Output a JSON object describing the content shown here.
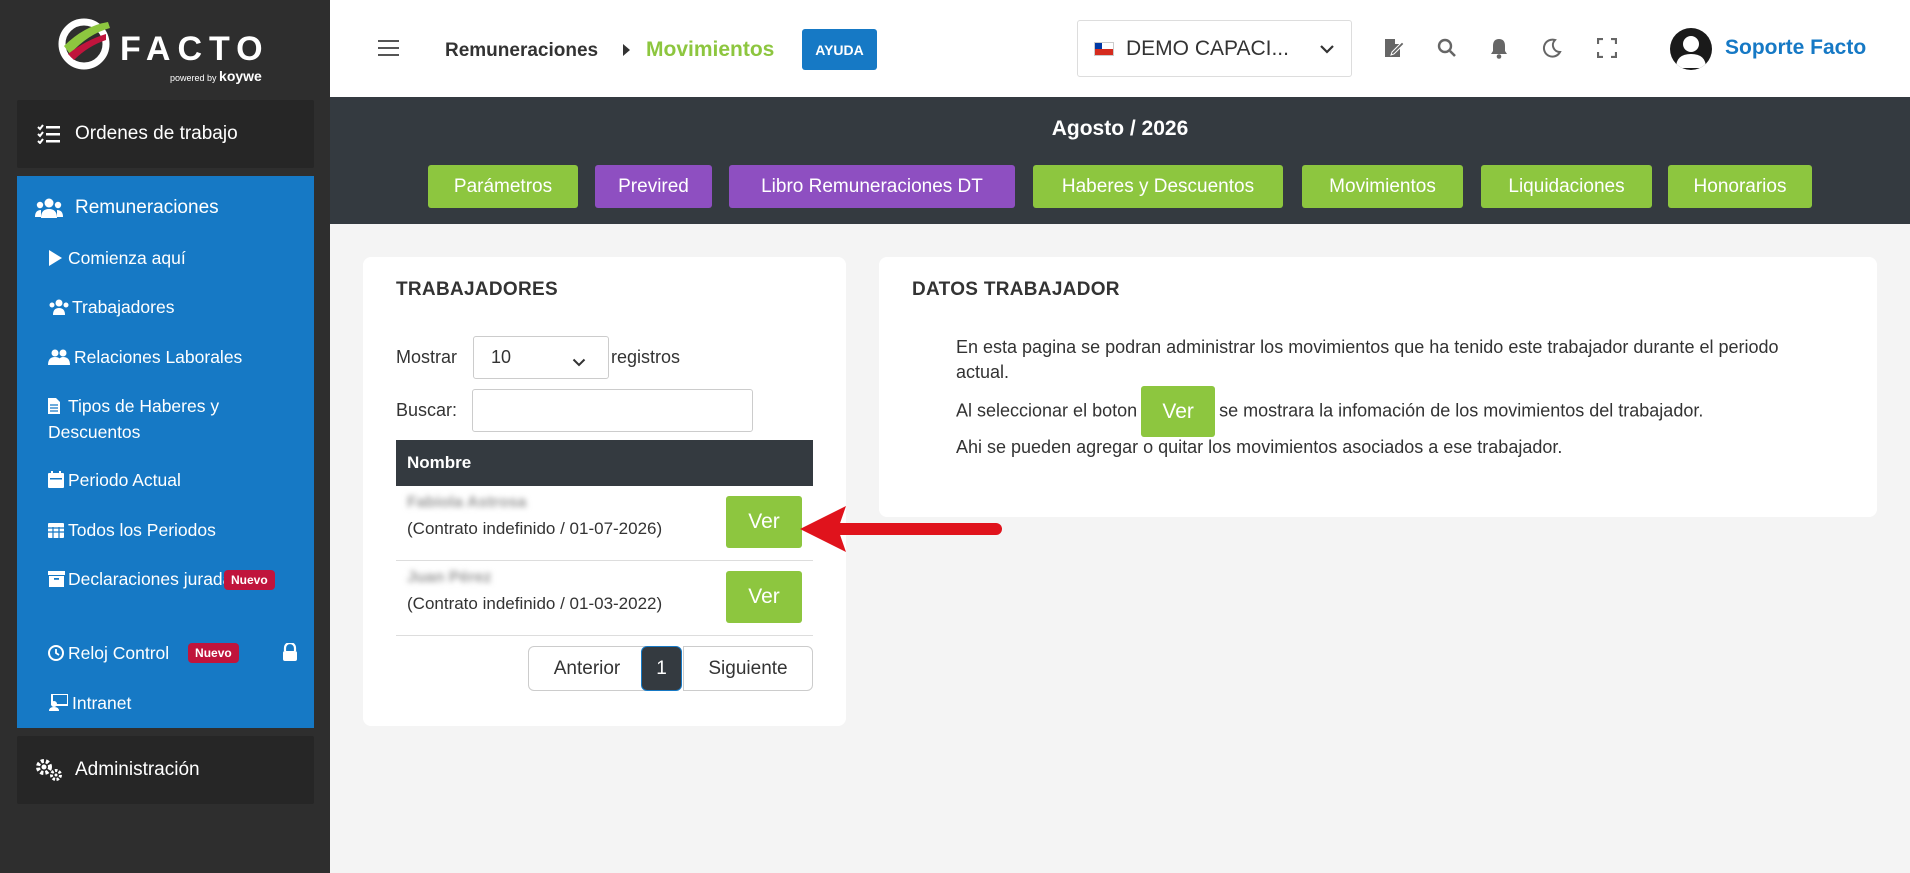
{
  "brand": {
    "name": "FACTO",
    "powered_by": "powered by",
    "partner": "koywe",
    "colors": {
      "green": "#8dc63f",
      "blue": "#1679c5",
      "purple": "#8e4fc1",
      "dark": "#343a40",
      "badge": "#c0143c"
    }
  },
  "sidebar": {
    "ordenes_label": "Ordenes de trabajo",
    "remuneraciones_label": "Remuneraciones",
    "items": [
      {
        "label": "Comienza aquí",
        "icon": "play-icon"
      },
      {
        "label": "Trabajadores",
        "icon": "users-icon"
      },
      {
        "label": "Relaciones Laborales",
        "icon": "user-group-icon"
      },
      {
        "label": "Tipos de Haberes y Descuentos",
        "icon": "file-icon"
      },
      {
        "label": "Periodo Actual",
        "icon": "calendar-icon"
      },
      {
        "label": "Todos los Periodos",
        "icon": "calendar-grid-icon"
      },
      {
        "label": "Declaraciones juradas",
        "icon": "archive-icon",
        "badge": "Nuevo"
      },
      {
        "label": "Reloj Control",
        "icon": "clock-icon",
        "badge": "Nuevo",
        "locked": true
      },
      {
        "label": "Intranet",
        "icon": "intranet-icon"
      }
    ],
    "admin_label": "Administración"
  },
  "topbar": {
    "breadcrumb_parent": "Remuneraciones",
    "breadcrumb_current": "Movimientos",
    "help_label": "AYUDA",
    "company": "DEMO CAPACI...",
    "user_name": "Soporte Facto"
  },
  "period": {
    "title": "Agosto / 2026",
    "tabs": [
      "Parámetros",
      "Previred",
      "Libro Remuneraciones DT",
      "Haberes y Descuentos",
      "Movimientos",
      "Liquidaciones",
      "Honorarios"
    ]
  },
  "workers": {
    "title": "TRABAJADORES",
    "show_label": "Mostrar",
    "show_value": "10",
    "records_label": "registros",
    "search_label": "Buscar:",
    "column_name": "Nombre",
    "rows": [
      {
        "name": "Fabiola Astrosa",
        "contract": "(Contrato indefinido / 01-07-2026)",
        "action": "Ver"
      },
      {
        "name": "Juan Pérez",
        "contract": "(Contrato indefinido / 01-03-2022)",
        "action": "Ver"
      }
    ],
    "pager": {
      "prev": "Anterior",
      "current": "1",
      "next": "Siguiente"
    }
  },
  "datos": {
    "title": "DATOS TRABAJADOR",
    "line1": "En esta pagina se podran administrar los movimientos que ha tenido este trabajador durante el periodo actual.",
    "line2_a": "Al seleccionar el boton",
    "line2_btn": "Ver",
    "line2_b": "se mostrara la infomación de los movimientos del trabajador.",
    "line3": "Ahi se pueden agregar o quitar los movimientos asociados a ese trabajador."
  }
}
